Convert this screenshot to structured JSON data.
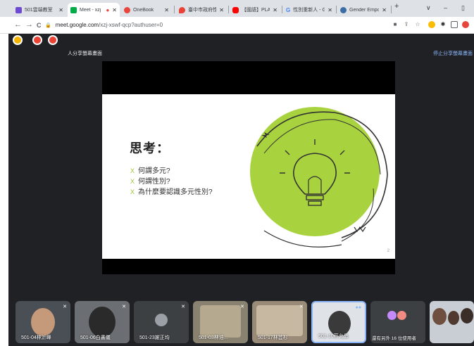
{
  "tabs": [
    {
      "label": "501雲端教室",
      "favicon_color": "#6d4ad1",
      "active": false
    },
    {
      "label": "Meet - xzj",
      "favicon_color": "#00ac47",
      "active": true
    },
    {
      "label": "OneBook",
      "favicon_color": "#e8453c",
      "active": false
    },
    {
      "label": "臺中市政府性別",
      "favicon_color": "#ea4335",
      "active": false
    },
    {
      "label": "【國語】PLAY",
      "favicon_color": "#ff0000",
      "active": false
    },
    {
      "label": "性別重新人 - G",
      "favicon_color": "#4285f4",
      "active": false
    },
    {
      "label": "Gender Empo",
      "favicon_color": "#3b6ea5",
      "active": false
    }
  ],
  "new_tab_label": "+",
  "window_controls": {
    "dropdown": "∨",
    "minimize": "–",
    "maximize": "▯"
  },
  "nav": {
    "back": "←",
    "forward": "→",
    "reload": "C"
  },
  "address": {
    "domain": "meet.google.com",
    "path": "/xzj-xswf-qcp?authuser=0"
  },
  "meet": {
    "presenting_text": "人分享螢幕畫面",
    "stop_presenting": "停止分享螢幕畫面"
  },
  "slide": {
    "title": "思考：",
    "bullets": [
      "何謂多元?",
      "何謂性別?",
      "為什麼要認識多元性別?"
    ],
    "bullet_mark": "X",
    "page_number": "2",
    "accent_color": "#9bc53d"
  },
  "participants": [
    {
      "name": "501-04林沂峰",
      "muted": true
    },
    {
      "name": "501-06白書儀",
      "muted": true
    },
    {
      "name": "501-23謝正均",
      "muted": true
    },
    {
      "name": "501-03林浩...",
      "muted": true
    },
    {
      "name": "501-17林芸杉",
      "muted": true
    },
    {
      "name": "501-10莊允晶",
      "muted": false
    },
    {
      "name": "還有另外 16 位使用者",
      "muted": false
    }
  ]
}
